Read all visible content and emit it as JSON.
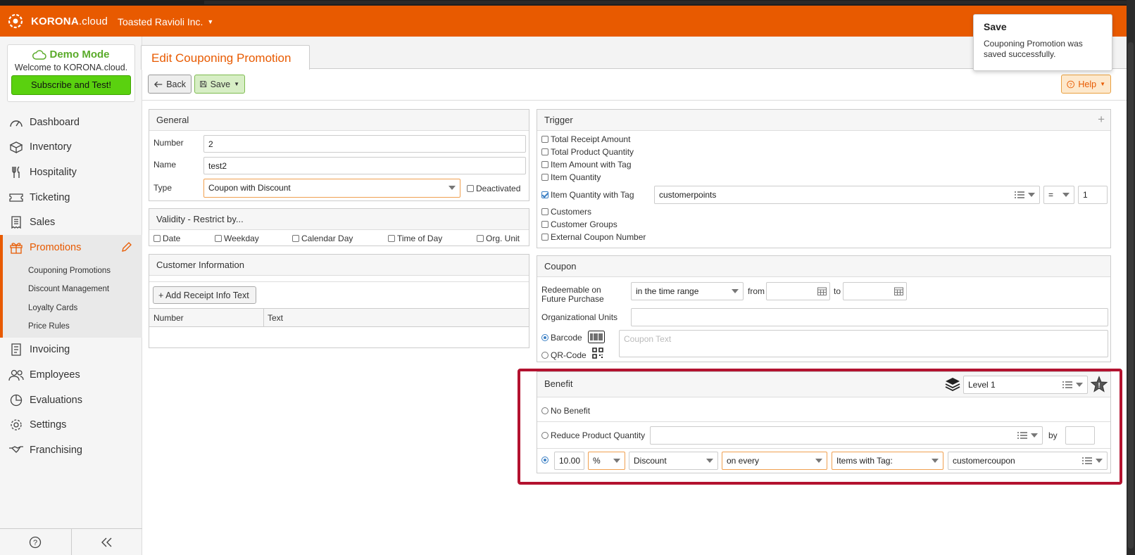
{
  "app": {
    "brand_strong": "KORONA",
    "brand_rest": ".cloud",
    "company": "Toasted Ravioli Inc."
  },
  "demo": {
    "title": "Demo Mode",
    "welcome": "Welcome to KORONA.cloud.",
    "subscribe": "Subscribe and Test!"
  },
  "nav": {
    "dashboard": "Dashboard",
    "inventory": "Inventory",
    "hospitality": "Hospitality",
    "ticketing": "Ticketing",
    "sales": "Sales",
    "promotions": "Promotions",
    "sub": {
      "couponing": "Couponing Promotions",
      "discount": "Discount Management",
      "loyalty": "Loyalty Cards",
      "price_rules": "Price Rules"
    },
    "invoicing": "Invoicing",
    "employees": "Employees",
    "evaluations": "Evaluations",
    "settings": "Settings",
    "franchising": "Franchising"
  },
  "page": {
    "tab_title": "Edit Couponing Promotion"
  },
  "toolbar": {
    "back": "Back",
    "save": "Save",
    "help": "Help"
  },
  "toast": {
    "title": "Save",
    "message": "Couponing Promotion was saved successfully."
  },
  "general": {
    "header": "General",
    "number_label": "Number",
    "number_value": "2",
    "name_label": "Name",
    "name_value": "test2",
    "type_label": "Type",
    "type_value": "Coupon with Discount",
    "deactivated": "Deactivated"
  },
  "validity": {
    "header": "Validity - Restrict by...",
    "date": "Date",
    "weekday": "Weekday",
    "calendar_day": "Calendar Day",
    "time_of_day": "Time of Day",
    "org_unit": "Org. Unit"
  },
  "customer_info": {
    "header": "Customer Information",
    "add_button": "+ Add Receipt Info Text",
    "col_number": "Number",
    "col_text": "Text"
  },
  "trigger": {
    "header": "Trigger",
    "total_receipt_amount": "Total Receipt Amount",
    "total_product_quantity": "Total Product Quantity",
    "item_amount_with_tag": "Item Amount with Tag",
    "item_quantity": "Item Quantity",
    "item_quantity_with_tag": "Item Quantity with Tag",
    "tag_value": "customerpoints",
    "operator": "=",
    "quantity": "1",
    "customers": "Customers",
    "customer_groups": "Customer Groups",
    "external_coupon_number": "External Coupon Number"
  },
  "coupon": {
    "header": "Coupon",
    "redeemable_label": "Redeemable on Future Purchase",
    "redeemable_value": "in the time range",
    "from": "from",
    "to": "to",
    "org_units_label": "Organizational Units",
    "barcode": "Barcode",
    "qrcode": "QR-Code",
    "coupon_text_placeholder": "Coupon Text"
  },
  "benefit": {
    "header": "Benefit",
    "level": "Level 1",
    "no_benefit": "No Benefit",
    "reduce_qty": "Reduce Product Quantity",
    "by": "by",
    "amount": "10.00",
    "unit": "%",
    "kind": "Discount",
    "scope": "on every",
    "target": "Items with Tag:",
    "tag": "customercoupon"
  },
  "colors": {
    "brand_orange": "#e85a00",
    "demo_green": "#5aab2a",
    "subscribe_green": "#5ad10f",
    "highlight_red": "#b3122f"
  }
}
